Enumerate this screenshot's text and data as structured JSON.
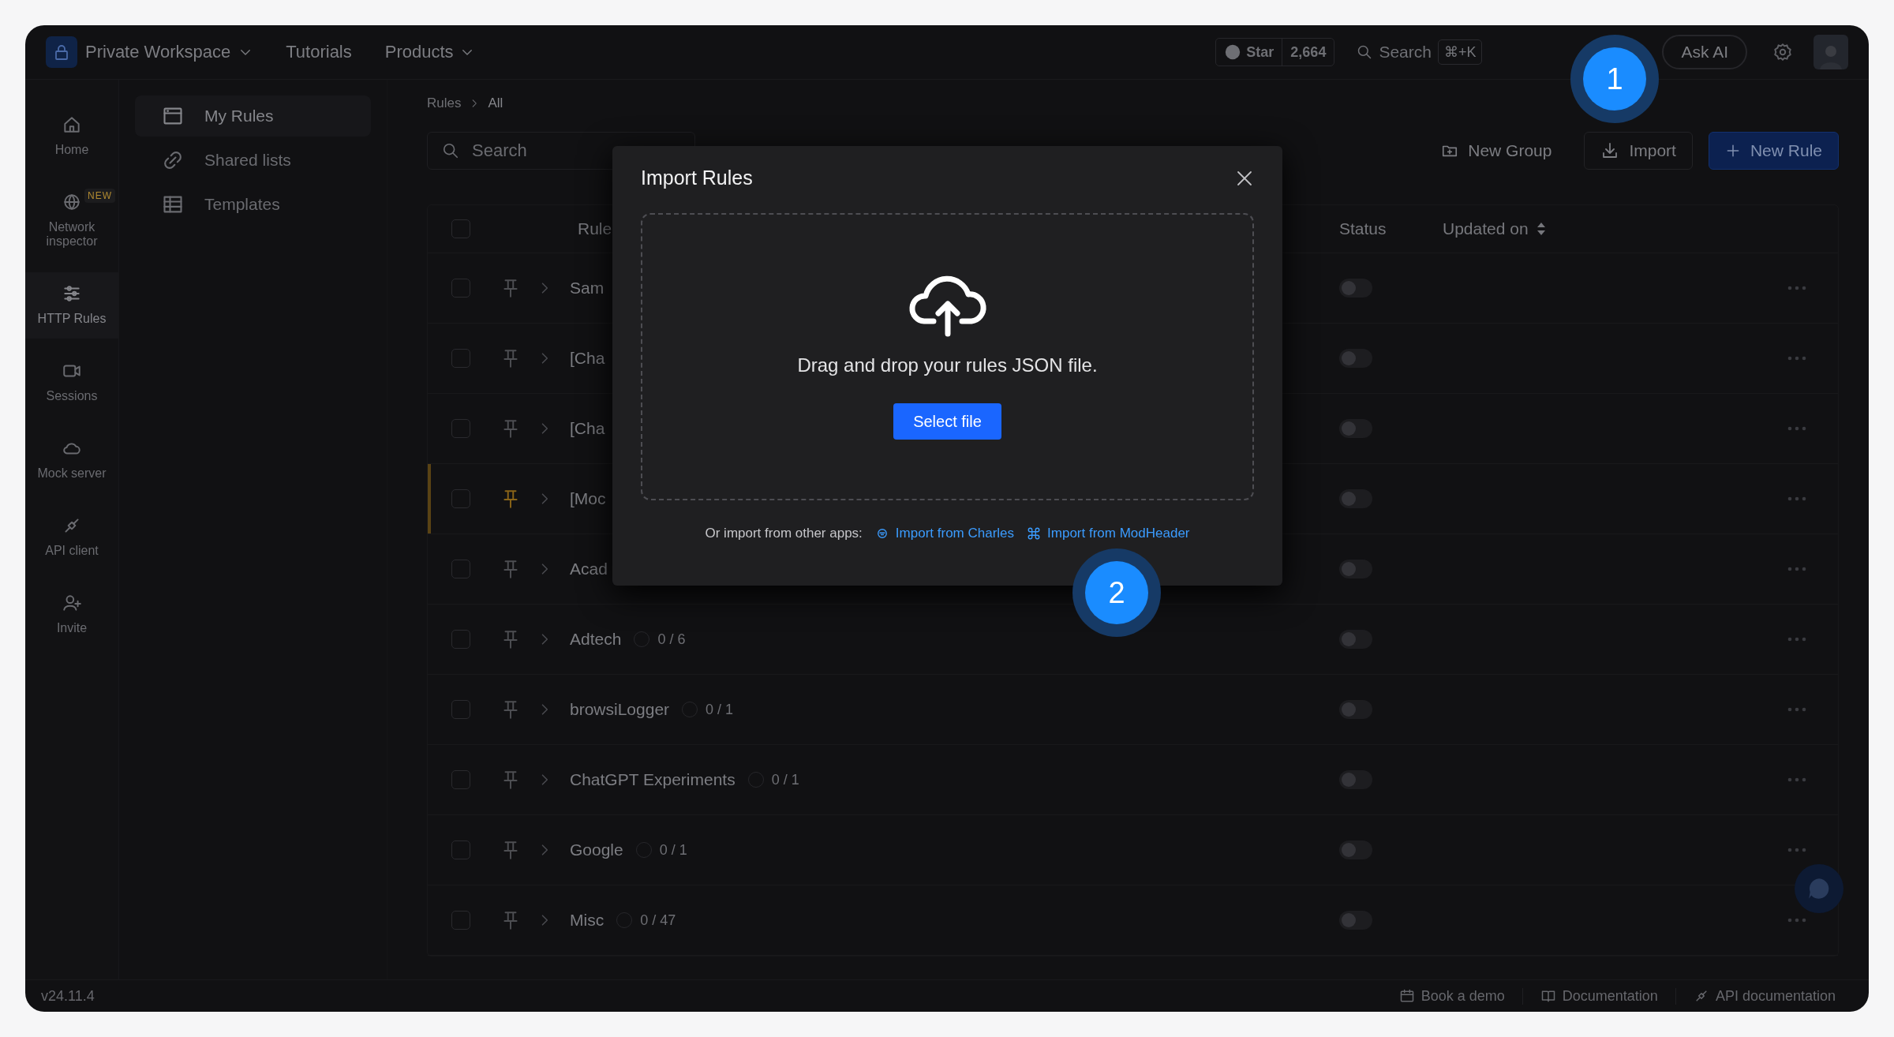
{
  "topbar": {
    "workspace": "Private Workspace",
    "nav": [
      {
        "label": "Tutorials",
        "dropdown": false
      },
      {
        "label": "Products",
        "dropdown": true
      }
    ],
    "github": {
      "label": "Star",
      "count": "2,664"
    },
    "search": {
      "placeholder": "Search",
      "shortcut": "⌘+K"
    },
    "ask_ai": "Ask AI"
  },
  "rail": [
    {
      "label": "Home",
      "selected": false
    },
    {
      "label": "Network inspector",
      "selected": false,
      "badge": "NEW"
    },
    {
      "label": "HTTP Rules",
      "selected": true
    },
    {
      "label": "Sessions",
      "selected": false
    },
    {
      "label": "Mock server",
      "selected": false
    },
    {
      "label": "API client",
      "selected": false
    }
  ],
  "invite": "Invite",
  "sidebar": [
    {
      "label": "My Rules",
      "selected": true
    },
    {
      "label": "Shared lists",
      "selected": false
    },
    {
      "label": "Templates",
      "selected": false
    }
  ],
  "breadcrumb": [
    "Rules",
    "All"
  ],
  "search": {
    "placeholder": "Search"
  },
  "actions": {
    "new_group": "New Group",
    "import": "Import",
    "new_rule": "New Rule"
  },
  "table": {
    "columns": [
      "Rule",
      "Status",
      "Updated on"
    ],
    "all_checked": false,
    "rows": [
      {
        "name": "Sam",
        "checked": false,
        "pinned": false,
        "on": false
      },
      {
        "name": "[Cha",
        "checked": false,
        "pinned": false,
        "on": false
      },
      {
        "name": "[Cha",
        "checked": false,
        "pinned": false,
        "on": false
      },
      {
        "name": "[Moc",
        "checked": false,
        "pinned": true,
        "on": false
      },
      {
        "name": "Acad",
        "checked": false,
        "pinned": false,
        "on": false
      },
      {
        "name": "Adtech",
        "count": "0 / 6",
        "checked": false,
        "pinned": false,
        "on": false
      },
      {
        "name": "browsiLogger",
        "count": "0 / 1",
        "checked": false,
        "pinned": false,
        "on": false
      },
      {
        "name": "ChatGPT Experiments",
        "count": "0 / 1",
        "checked": false,
        "pinned": false,
        "on": false
      },
      {
        "name": "Google",
        "count": "0 / 1",
        "checked": false,
        "pinned": false,
        "on": false
      },
      {
        "name": "Misc",
        "count": "0 / 47",
        "checked": false,
        "pinned": false,
        "on": false
      }
    ]
  },
  "modal": {
    "title": "Import Rules",
    "prompt": "Drag and drop your rules JSON file.",
    "button": "Select file",
    "other_label": "Or import from other apps:",
    "links": [
      "Import from Charles",
      "Import from ModHeader"
    ]
  },
  "callouts": [
    "1",
    "2"
  ],
  "version": "v24.11.4",
  "footer": [
    "Book a demo",
    "Documentation",
    "API documentation"
  ]
}
